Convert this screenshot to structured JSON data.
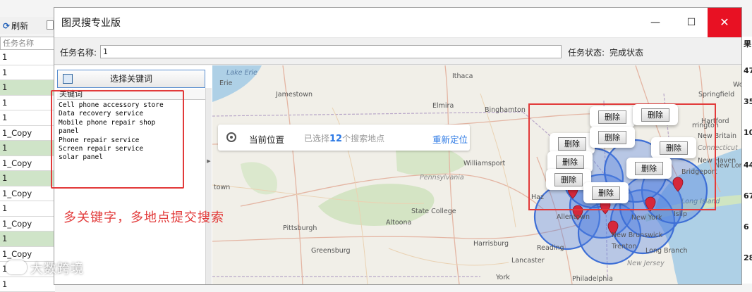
{
  "background_app": {
    "refresh_label": "刷新",
    "column_header": "任务名称",
    "rows": [
      {
        "name": "1",
        "highlight": false
      },
      {
        "name": "1",
        "highlight": false
      },
      {
        "name": "1",
        "highlight": true
      },
      {
        "name": "1",
        "highlight": false
      },
      {
        "name": "1",
        "highlight": false
      },
      {
        "name": "1_Copy",
        "highlight": false
      },
      {
        "name": "1",
        "highlight": true
      },
      {
        "name": "1_Copy",
        "highlight": false
      },
      {
        "name": "1",
        "highlight": true
      },
      {
        "name": "1_Copy",
        "highlight": false
      },
      {
        "name": "1",
        "highlight": false
      },
      {
        "name": "1_Copy",
        "highlight": false
      },
      {
        "name": "1",
        "highlight": true
      },
      {
        "name": "1_Copy",
        "highlight": false
      },
      {
        "name": "1",
        "highlight": false
      },
      {
        "name": "1",
        "highlight": false
      }
    ],
    "right_header": "果",
    "right_values": [
      "47",
      "35",
      "10",
      "44",
      "67",
      "6",
      "28"
    ]
  },
  "window": {
    "title": "图灵搜专业版",
    "controls": {
      "minimize": "—",
      "maximize": "☐",
      "close": "✕"
    },
    "task_name_label": "任务名称:",
    "task_name_value": "1",
    "task_status_label": "任务状态:",
    "task_status_value": "完成状态"
  },
  "keywords": {
    "select_button": "选择关键词",
    "column_header": "关键词",
    "items": [
      "Cell phone accessory store",
      "Data recovery service",
      "Mobile phone repair shop",
      "panel",
      "Phone repair service",
      "Screen repair service",
      "solar panel"
    ]
  },
  "annotation": "多关键字，多地点提交搜索",
  "map": {
    "location_label": "当前位置",
    "selected_prefix": "已选择",
    "selected_count": "12",
    "selected_suffix": "个搜索地点",
    "relocate": "重新定位",
    "delete_label": "删除",
    "place_labels": {
      "ithaca": "Ithaca",
      "jamestown": "Jamestown",
      "elmira": "Elmira",
      "binghamton": "Binghamton",
      "springfield": "Springfield",
      "hartford": "Hartford",
      "new_britain": "New Britain",
      "connecticut": "Connecticut",
      "new_haven": "New Haven",
      "new_london": "New Lon",
      "bridgeport": "Bridgeport",
      "long_island": "Long Island",
      "islip": "Islip",
      "new_york": "New York",
      "new_brunswick": "New Brunswick",
      "long_branch": "Long Branch",
      "trenton": "Trenton",
      "new_jersey": "New Jersey",
      "philadelphia": "Philadelphia",
      "reading": "Reading",
      "allentown": "Allentown",
      "harrisburg": "Harrisburg",
      "lancaster": "Lancaster",
      "york": "York",
      "williamsport": "Williamsport",
      "pennsylvania": "Pennsylvania",
      "state_college": "State College",
      "altoona": "Altoona",
      "pittsburgh": "Pittsburgh",
      "greensburg": "Greensburg",
      "erie": "Erie",
      "town": "town",
      "harrington": "rrington",
      "hazleton": "Haz",
      "lake_erie": "Lake Erie",
      "wo": "Wo"
    }
  },
  "watermark": "大数跨境",
  "colors": {
    "accent": "#2b78e4",
    "annotation_red": "#e23a3a",
    "close_red": "#e81123",
    "row_highlight": "#cfe4c8",
    "search_circle": "#4d7de0",
    "marker": "#d6283b"
  }
}
